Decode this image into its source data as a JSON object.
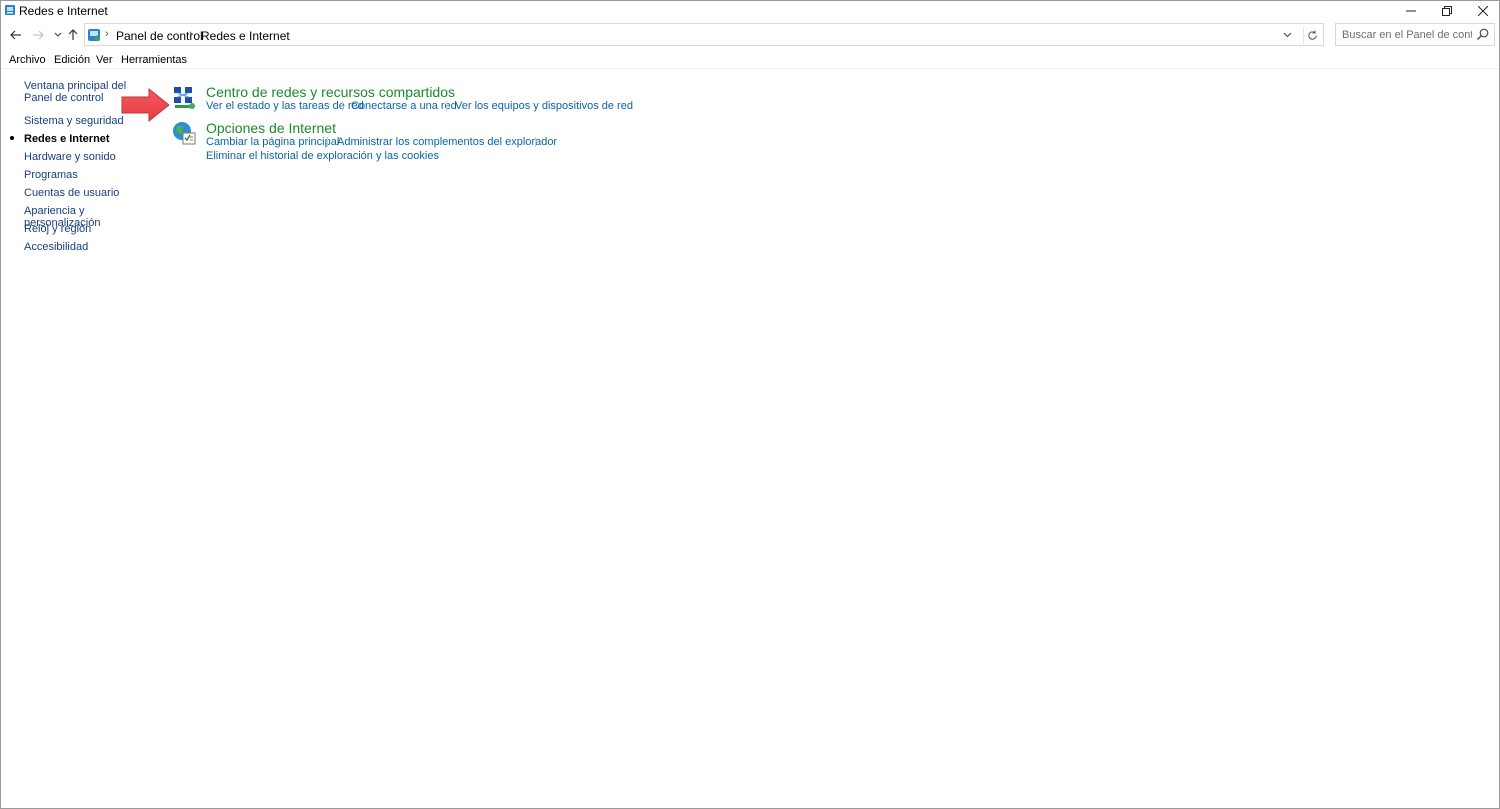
{
  "window": {
    "title": "Redes e Internet",
    "minimize_icon": "minimize-icon",
    "maximize_icon": "restore-icon",
    "close_icon": "close-icon"
  },
  "address": {
    "crumbs": [
      "Panel de control",
      "Redes e Internet"
    ],
    "search_placeholder": "Buscar en el Panel de control"
  },
  "menu": {
    "items": [
      "Archivo",
      "Edición",
      "Ver",
      "Herramientas"
    ]
  },
  "sidebar": {
    "home_label": "Ventana principal del Panel de control",
    "items": [
      {
        "label": "Sistema y seguridad",
        "active": false
      },
      {
        "label": "Redes e Internet",
        "active": true
      },
      {
        "label": "Hardware y sonido",
        "active": false
      },
      {
        "label": "Programas",
        "active": false
      },
      {
        "label": "Cuentas de usuario",
        "active": false
      },
      {
        "label": "Apariencia y personalización",
        "active": false
      },
      {
        "label": "Reloj y región",
        "active": false
      },
      {
        "label": "Accesibilidad",
        "active": false
      }
    ]
  },
  "categories": [
    {
      "title": "Centro de redes y recursos compartidos",
      "icon": "network-center-icon",
      "links": [
        "Ver el estado y las tareas de red",
        "Conectarse a una red",
        "Ver los equipos y dispositivos de red"
      ]
    },
    {
      "title": "Opciones de Internet",
      "icon": "internet-options-icon",
      "links": [
        "Cambiar la página principal",
        "Administrar los complementos del explorador",
        "Eliminar el historial de exploración y las cookies"
      ]
    }
  ],
  "colors": {
    "category_title": "#1a8a2e",
    "link": "#0b63a8",
    "annotation_arrow": "#ee4b50"
  }
}
